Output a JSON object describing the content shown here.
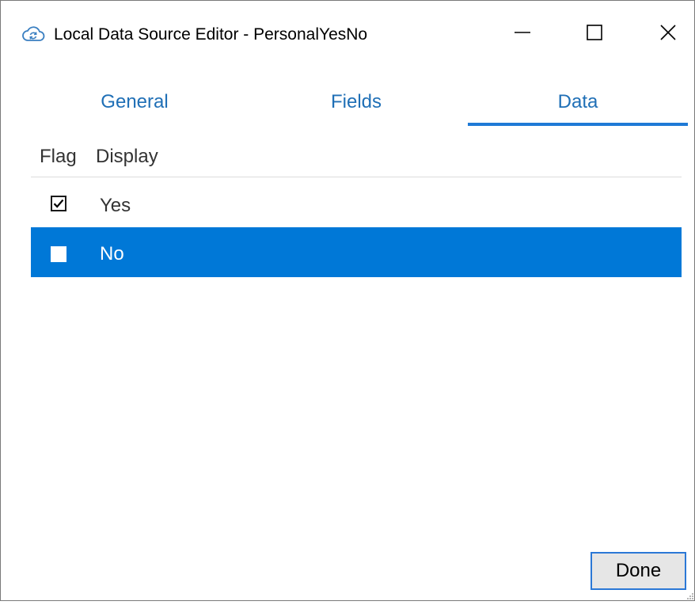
{
  "window": {
    "title": "Local Data Source Editor - PersonalYesNo",
    "app_icon": "cloud-sync-icon",
    "controls": {
      "minimize": "minimize-icon",
      "maximize": "maximize-icon",
      "close": "close-icon"
    }
  },
  "tabs": [
    {
      "label": "General",
      "active": false
    },
    {
      "label": "Fields",
      "active": false
    },
    {
      "label": "Data",
      "active": true
    }
  ],
  "grid": {
    "columns": [
      "Flag",
      "Display"
    ],
    "rows": [
      {
        "flag": true,
        "display": "Yes",
        "selected": false
      },
      {
        "flag": false,
        "display": "No",
        "selected": true
      }
    ]
  },
  "footer": {
    "done_label": "Done"
  },
  "colors": {
    "accent": "#1f7ad6",
    "tab_text": "#1f6fb6",
    "selection": "#0078d7"
  }
}
